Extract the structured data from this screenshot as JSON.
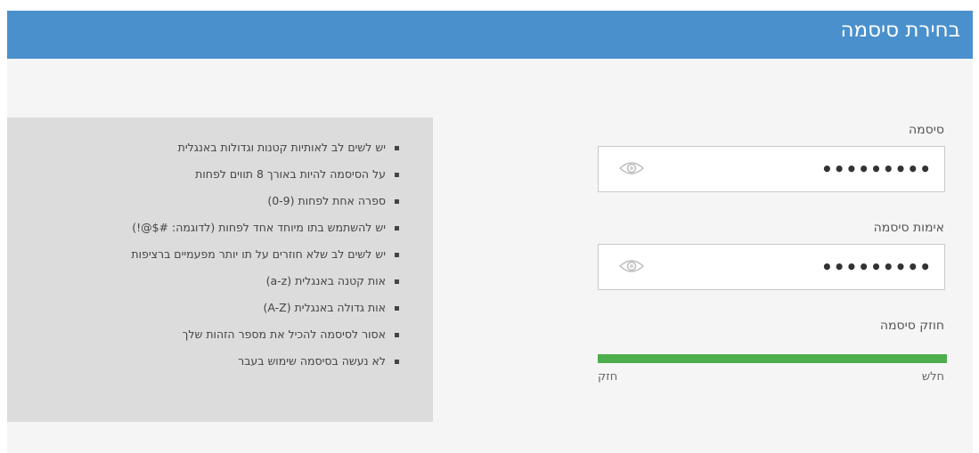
{
  "header": {
    "title": "בחירת סיסמה"
  },
  "colors": {
    "header_bg": "#4a90cc",
    "panel_bg": "#f5f5f5",
    "rules_bg": "#dcdcdc",
    "strength_bar": "#4cae4c"
  },
  "password": {
    "label": "סיסמה",
    "value": "•••••••••",
    "toggle_icon": "eye-icon"
  },
  "confirm_password": {
    "label": "אימות סיסמה",
    "value": "•••••••••",
    "toggle_icon": "eye-icon"
  },
  "strength": {
    "label": "חוזק סיסמה",
    "weak_label": "חלש",
    "strong_label": "חזק",
    "level": 1.0
  },
  "rules": [
    "יש לשים לב לאותיות קטנות וגדולות באנגלית",
    "על הסיסמה להיות באורך 8 תווים לפחות",
    "ספרה אחת לפחות (0-9)",
    "יש להשתמש בתו מיוחד אחד לפחות (לדוגמה: #$@!)",
    "יש לשים לב שלא חוזרים על תו יותר מפעמיים ברציפות",
    "אות קטנה באנגלית (a-z)",
    "אות גדולה באנגלית (A-Z)",
    "אסור לסיסמה להכיל את מספר הזהות שלך",
    "לא נעשה בסיסמה שימוש בעבר"
  ]
}
